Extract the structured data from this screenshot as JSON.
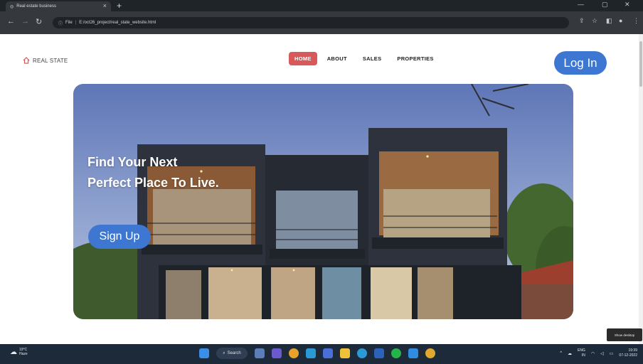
{
  "browser": {
    "tab_title": "Real estate business",
    "tab_close": "×",
    "new_tab": "+",
    "url_prefix": "File",
    "url": "E:/oct26_project/real_state_website.html",
    "window_controls": [
      "—",
      "▢",
      "✕"
    ]
  },
  "site": {
    "brand": "REAL STATE",
    "nav": [
      {
        "label": "HOME",
        "active": true
      },
      {
        "label": "ABOUT",
        "active": false
      },
      {
        "label": "SALES",
        "active": false
      },
      {
        "label": "PROPERTIES",
        "active": false
      }
    ],
    "login_label": "Log In",
    "hero_title": "Find Your Next Perfect Place To Live.",
    "signup_label": "Sign Up"
  },
  "tooltip": "Show desktop",
  "taskbar": {
    "weather_temp": "19°C",
    "weather_desc": "Haze",
    "search_label": "Search",
    "lang": "ENG",
    "region": "IN",
    "time": "19:39",
    "date": "07-12-2022"
  },
  "colors": {
    "accent_blue": "#3d77d2",
    "nav_active": "#d9585a"
  }
}
